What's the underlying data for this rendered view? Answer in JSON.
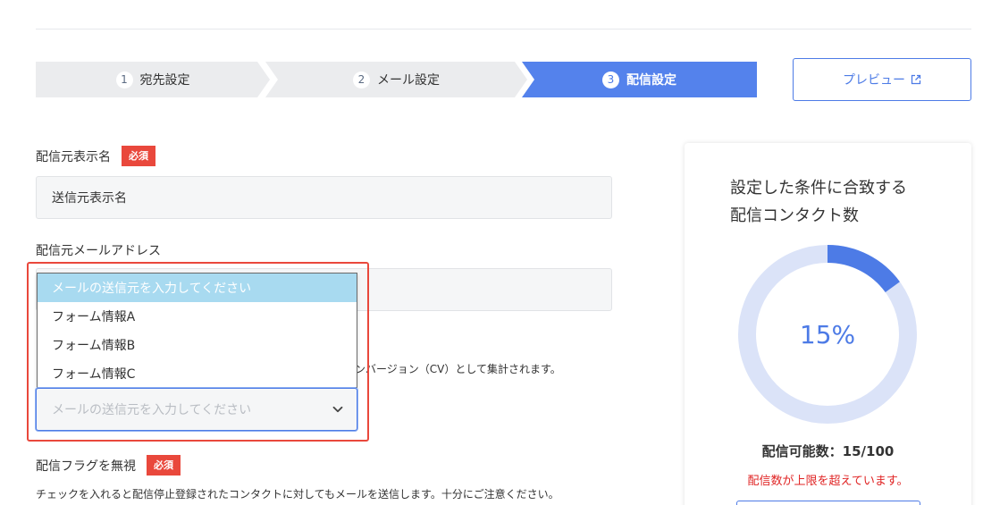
{
  "stepper": {
    "steps": [
      {
        "number": "1",
        "label": "宛先設定",
        "state": "done"
      },
      {
        "number": "2",
        "label": "メール設定",
        "state": "done"
      },
      {
        "number": "3",
        "label": "配信設定",
        "state": "active"
      }
    ],
    "preview_label": "プレビュー",
    "preview_icon": "external-link-icon"
  },
  "form": {
    "sender_name": {
      "label": "配信元表示名",
      "required_badge": "必須",
      "value": "送信元表示名"
    },
    "sender_email": {
      "label": "配信元メールアドレス"
    },
    "dropdown": {
      "options": [
        {
          "label": "メールの送信元を入力してください",
          "selected": true
        },
        {
          "label": "フォーム情報A",
          "selected": false
        },
        {
          "label": "フォーム情報B",
          "selected": false
        },
        {
          "label": "フォーム情報C",
          "selected": false
        }
      ],
      "select_placeholder": "メールの送信元を入力してください"
    },
    "cv_helper_text": "はコンバージョン（CV）として集計されます。",
    "ignore_flag": {
      "label": "配信フラグを無視",
      "required_badge": "必須",
      "helper": "チェックを入れると配信停止登録されたコンタクトに対してもメールを送信します。十分にご注意ください。"
    }
  },
  "count_card": {
    "title_line1": "設定した条件に合致する",
    "title_line2": "配信コンタクト数",
    "percent": 15,
    "percent_label": "15%",
    "available_label": "配信可能数：15/100",
    "warning": "配信数が上限を超えています。",
    "colors": {
      "ring_bg": "#dbe3f8",
      "ring_fg": "#4d7be6",
      "warning": "#e02424"
    }
  },
  "colors": {
    "accent": "#4d7be6",
    "required": "#e9483c",
    "step_inactive": "#ebecee"
  }
}
